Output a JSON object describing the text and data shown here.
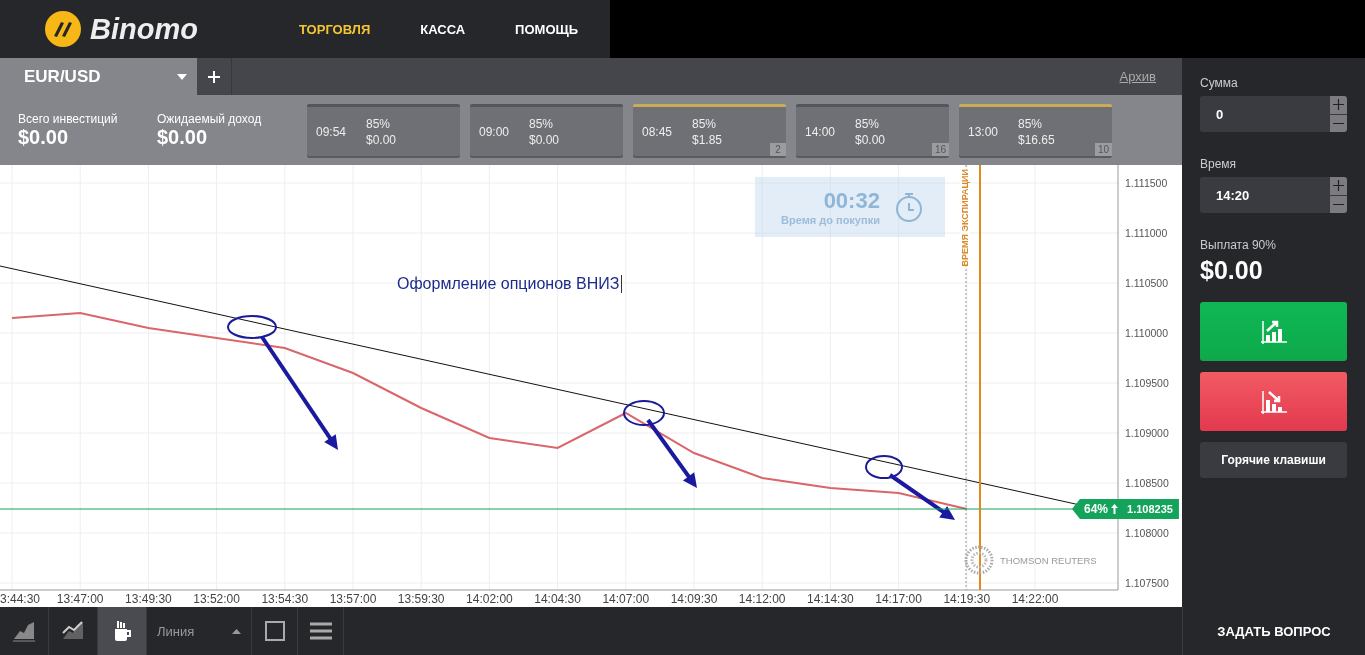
{
  "header": {
    "logo_text": "Binomo",
    "nav": [
      {
        "label": "ТОРГОВЛЯ",
        "selected": true
      },
      {
        "label": "КАССА",
        "selected": false
      },
      {
        "label": "ПОМОЩЬ",
        "selected": false
      }
    ]
  },
  "asset_tab": {
    "label": "EUR/USD",
    "archive": "Архив"
  },
  "summary": [
    {
      "label": "Всего инвестиций",
      "value": "$0.00"
    },
    {
      "label": "Ожидаемый доход",
      "value": "$0.00"
    }
  ],
  "deals": [
    {
      "time": "09:54",
      "percent": "85%",
      "amount": "$0.00",
      "active": false
    },
    {
      "time": "09:00",
      "percent": "85%",
      "amount": "$0.00",
      "active": false
    },
    {
      "time": "08:45",
      "percent": "85%",
      "amount": "$1.85",
      "active": true,
      "count": "2"
    },
    {
      "time": "14:00",
      "percent": "85%",
      "amount": "$0.00",
      "active": false,
      "count": "16"
    },
    {
      "time": "13:00",
      "percent": "85%",
      "amount": "$16.65",
      "active": true,
      "count": "10"
    }
  ],
  "chart": {
    "timer": {
      "value": "00:32",
      "label": "Время до покупки"
    },
    "expiry_label": "ВРЕМЯ ЭКСПИРАЦИИ",
    "note": "Оформление опционов ВНИЗ",
    "price_badge": {
      "percent": "64%",
      "price": "1.108235"
    },
    "provider": "THOMSON REUTERS",
    "chart_data": {
      "type": "line",
      "categories": [
        "3:44:30",
        "13:47:00",
        "13:49:30",
        "13:52:00",
        "13:54:30",
        "13:57:00",
        "13:59:30",
        "14:02:00",
        "14:04:30",
        "14:07:00",
        "14:09:30",
        "14:12:00",
        "14:14:30",
        "14:17:00",
        "14:19:30",
        "14:22:00"
      ],
      "series": [
        {
          "color": "#d9666a",
          "values": [
            1.11015,
            1.1102,
            1.11005,
            1.10995,
            1.10985,
            1.1096,
            1.10925,
            1.10895,
            1.10885,
            1.1092,
            1.1088,
            1.10855,
            1.10845,
            1.1084,
            1.10824,
            null
          ]
        }
      ],
      "ylim": [
        1.10743,
        1.11168
      ],
      "grid": true,
      "ref_lines": [
        {
          "axis": "y",
          "value": 1.10824,
          "color": "#13a35a"
        }
      ],
      "yticks": [
        {
          "value": 1.1075,
          "label": "1.107500"
        },
        {
          "value": 1.108,
          "label": "1.108000"
        },
        {
          "value": 1.1085,
          "label": "1.108500"
        },
        {
          "value": 1.109,
          "label": "1.109000"
        },
        {
          "value": 1.1095,
          "label": "1.109500"
        },
        {
          "value": 1.11,
          "label": "1.110000"
        },
        {
          "value": 1.1105,
          "label": "1.110500"
        },
        {
          "value": 1.111,
          "label": "1.111000"
        },
        {
          "value": 1.1115,
          "label": "1.111500"
        }
      ]
    }
  },
  "side": {
    "amount_label": "Сумма",
    "amount": "0",
    "time_label": "Время",
    "time": "14:20",
    "payout_label": "Выплата 90%",
    "payout": "$0.00",
    "hotkeys": "Горячие клавиши"
  },
  "toolbar": {
    "tools": [
      {
        "kind": "area",
        "selected": false
      },
      {
        "kind": "line",
        "selected": false
      },
      {
        "kind": "draw",
        "selected": true
      }
    ],
    "chart_type": "Линия"
  },
  "ask_button": "ЗАДАТЬ ВОПРОС"
}
